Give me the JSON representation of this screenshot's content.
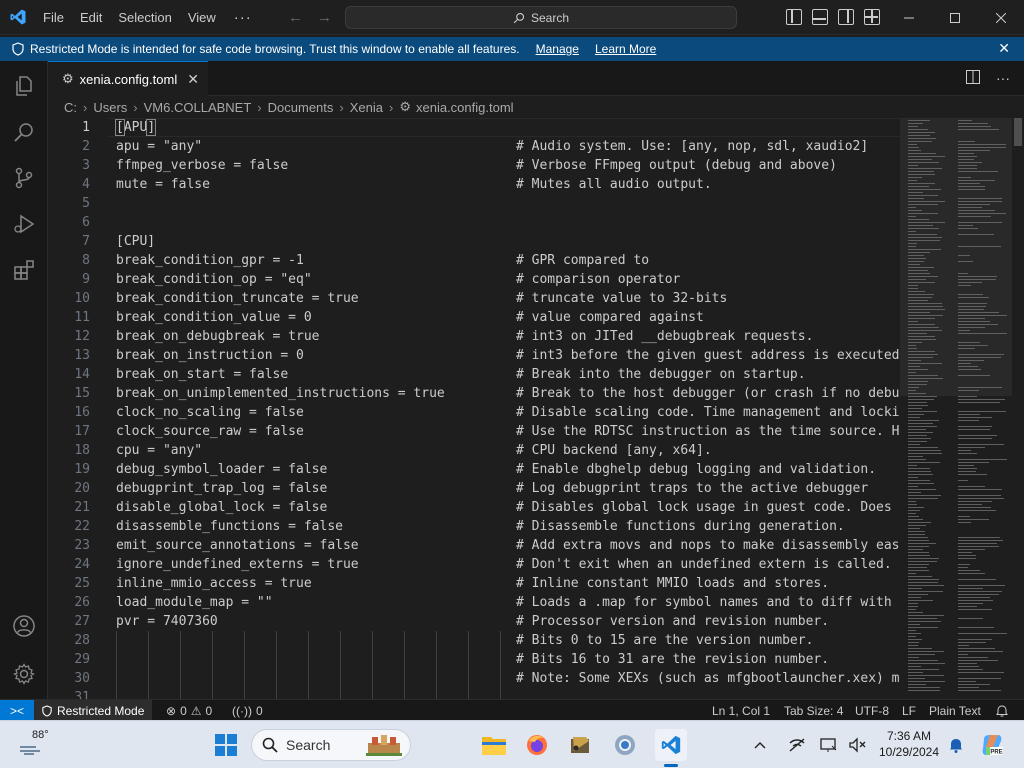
{
  "titlebar": {
    "menus": [
      "File",
      "Edit",
      "Selection",
      "View"
    ],
    "more": "···",
    "search_label": "Search"
  },
  "banner": {
    "text": "Restricted Mode is intended for safe code browsing. Trust this window to enable all features.",
    "manage": "Manage",
    "learn_more": "Learn More"
  },
  "tab": {
    "label": "xenia.config.toml"
  },
  "breadcrumb": [
    "C:",
    "Users",
    "VM6.COLLABNET",
    "Documents",
    "Xenia",
    "xenia.config.toml"
  ],
  "editor": {
    "lines": [
      {
        "n": "1",
        "code": "[APU]",
        "comment": ""
      },
      {
        "n": "2",
        "code": "apu = \"any\"",
        "comment": "# Audio system. Use: [any, nop, sdl, xaudio2]"
      },
      {
        "n": "3",
        "code": "ffmpeg_verbose = false",
        "comment": "# Verbose FFmpeg output (debug and above)"
      },
      {
        "n": "4",
        "code": "mute = false",
        "comment": "# Mutes all audio output."
      },
      {
        "n": "5",
        "code": "",
        "comment": ""
      },
      {
        "n": "6",
        "code": "",
        "comment": ""
      },
      {
        "n": "7",
        "code": "[CPU]",
        "comment": ""
      },
      {
        "n": "8",
        "code": "break_condition_gpr = -1",
        "comment": "# GPR compared to"
      },
      {
        "n": "9",
        "code": "break_condition_op = \"eq\"",
        "comment": "# comparison operator"
      },
      {
        "n": "10",
        "code": "break_condition_truncate = true",
        "comment": "# truncate value to 32-bits"
      },
      {
        "n": "11",
        "code": "break_condition_value = 0",
        "comment": "# value compared against"
      },
      {
        "n": "12",
        "code": "break_on_debugbreak = true",
        "comment": "# int3 on JITed __debugbreak requests."
      },
      {
        "n": "13",
        "code": "break_on_instruction = 0",
        "comment": "# int3 before the given guest address is executed."
      },
      {
        "n": "14",
        "code": "break_on_start = false",
        "comment": "# Break into the debugger on startup."
      },
      {
        "n": "15",
        "code": "break_on_unimplemented_instructions = true",
        "comment": "# Break to the host debugger (or crash if no debug"
      },
      {
        "n": "16",
        "code": "clock_no_scaling = false",
        "comment": "# Disable scaling code. Time management and lockin"
      },
      {
        "n": "17",
        "code": "clock_source_raw = false",
        "comment": "# Use the RDTSC instruction as the time source. Ho"
      },
      {
        "n": "18",
        "code": "cpu = \"any\"",
        "comment": "# CPU backend [any, x64]."
      },
      {
        "n": "19",
        "code": "debug_symbol_loader = false",
        "comment": "# Enable dbghelp debug logging and validation."
      },
      {
        "n": "20",
        "code": "debugprint_trap_log = false",
        "comment": "# Log debugprint traps to the active debugger"
      },
      {
        "n": "21",
        "code": "disable_global_lock = false",
        "comment": "# Disables global lock usage in guest code. Does n"
      },
      {
        "n": "22",
        "code": "disassemble_functions = false",
        "comment": "# Disassemble functions during generation."
      },
      {
        "n": "23",
        "code": "emit_source_annotations = false",
        "comment": "# Add extra movs and nops to make disassembly easi"
      },
      {
        "n": "24",
        "code": "ignore_undefined_externs = true",
        "comment": "# Don't exit when an undefined extern is called."
      },
      {
        "n": "25",
        "code": "inline_mmio_access = true",
        "comment": "# Inline constant MMIO loads and stores."
      },
      {
        "n": "26",
        "code": "load_module_map = \"\"",
        "comment": "# Loads a .map for symbol names and to diff with t"
      },
      {
        "n": "27",
        "code": "pvr = 7407360",
        "comment": "# Processor version and revision number."
      },
      {
        "n": "28",
        "code": "",
        "comment": "# Bits 0 to 15 are the version number."
      },
      {
        "n": "29",
        "code": "",
        "comment": "# Bits 16 to 31 are the revision number."
      },
      {
        "n": "30",
        "code": "",
        "comment": "# Note: Some XEXs (such as mfgbootlauncher.xex) ma"
      },
      {
        "n": "31",
        "code": "",
        "comment": ""
      }
    ]
  },
  "statusbar": {
    "remote_icon": "remote-icon",
    "restricted": "Restricted Mode",
    "errors": "0",
    "warnings": "0",
    "ports": "0",
    "position": "Ln 1, Col 1",
    "tab_size": "Tab Size: 4",
    "encoding": "UTF-8",
    "eol": "LF",
    "language": "Plain Text"
  },
  "taskbar": {
    "weather": "88°",
    "search": "Search",
    "time": "7:36 AM",
    "date": "10/29/2024"
  },
  "colors": {
    "accent": "#0078d4",
    "banner": "#0b4a7d",
    "editor_bg": "#1e1e1e"
  }
}
